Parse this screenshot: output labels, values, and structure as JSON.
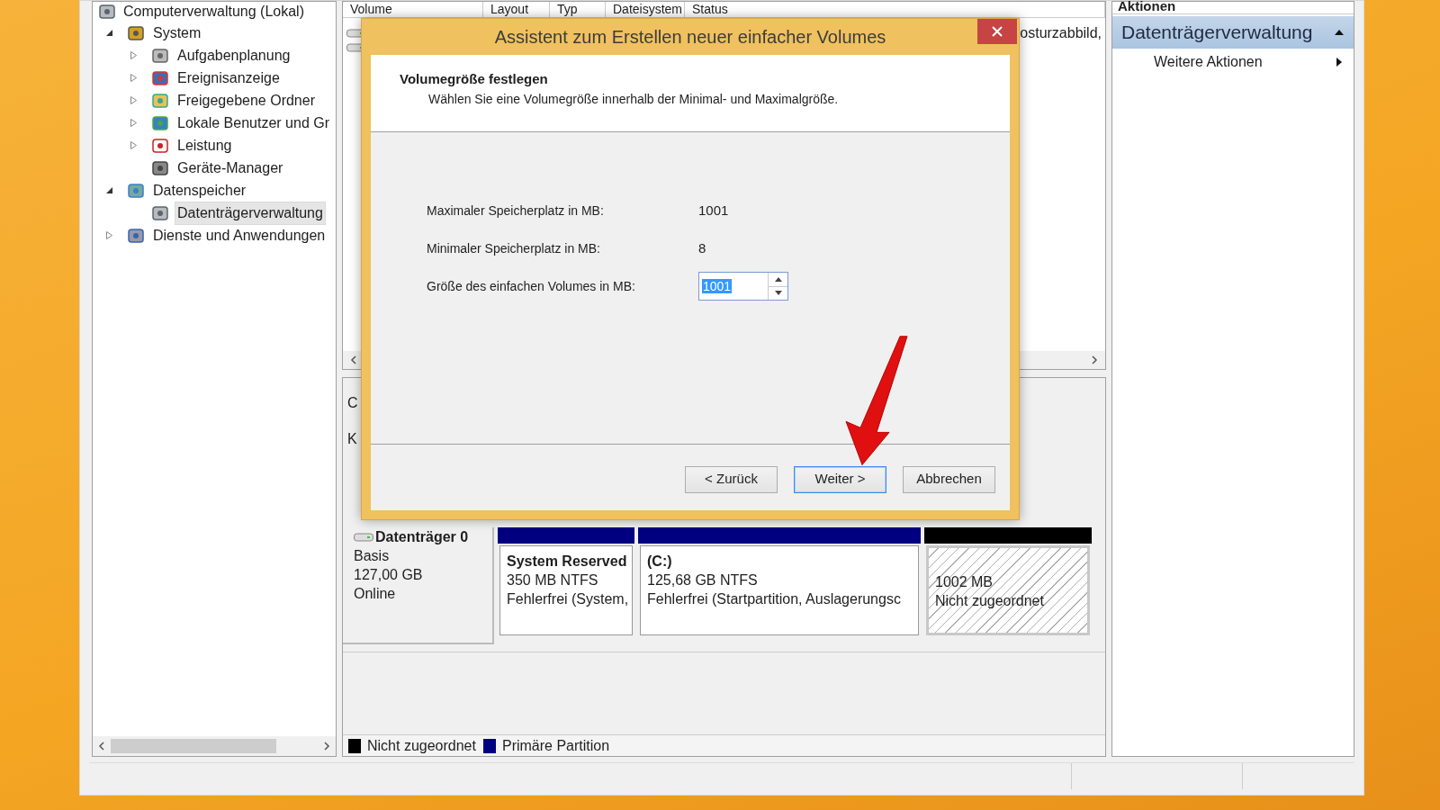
{
  "tree": {
    "root": "Computerverwaltung (Lokal)",
    "items": [
      {
        "label": "System",
        "kind": "node",
        "expanded": true,
        "selected": false,
        "children": [
          {
            "label": "Aufgabenplanung",
            "kind": "node",
            "expanded": false,
            "selected": false
          },
          {
            "label": "Ereignisanzeige",
            "kind": "node",
            "expanded": false,
            "selected": false
          },
          {
            "label": "Freigegebene Ordner",
            "kind": "node",
            "expanded": false,
            "selected": false
          },
          {
            "label": "Lokale Benutzer und Gr",
            "kind": "node",
            "expanded": false,
            "selected": false
          },
          {
            "label": "Leistung",
            "kind": "node",
            "expanded": false,
            "selected": false
          },
          {
            "label": "Geräte-Manager",
            "kind": "leaf",
            "selected": false
          }
        ]
      },
      {
        "label": "Datenspeicher",
        "kind": "node",
        "expanded": true,
        "selected": false,
        "children": [
          {
            "label": "Datenträgerverwaltung",
            "kind": "leaf",
            "selected": true
          }
        ]
      },
      {
        "label": "Dienste und Anwendungen",
        "kind": "node",
        "expanded": false,
        "selected": false
      }
    ]
  },
  "volume_list": {
    "columns": [
      "Volume",
      "Layout",
      "Typ",
      "Dateisystem",
      "Status"
    ],
    "rows": [
      {
        "status_fragment": "osturzabbild,"
      }
    ]
  },
  "lower_pane_fragments": [
    "C",
    "K"
  ],
  "disk": {
    "name": "Datenträger 0",
    "type": "Basis",
    "size": "127,00 GB",
    "status": "Online",
    "partitions": [
      {
        "kind": "primary",
        "name": "System Reserved",
        "size": "350 MB NTFS",
        "status": "Fehlerfrei (System,"
      },
      {
        "kind": "primary",
        "name": "(C:)",
        "size": "125,68 GB NTFS",
        "status": "Fehlerfrei (Startpartition, Auslagerungsc"
      },
      {
        "kind": "unallocated",
        "size": "1002 MB",
        "status": "Nicht zugeordnet"
      }
    ]
  },
  "legend": [
    {
      "label": "Nicht zugeordnet",
      "color": "#000000"
    },
    {
      "label": "Primäre Partition",
      "color": "#000080"
    }
  ],
  "actions": {
    "title": "Aktionen",
    "section": {
      "label": "Datenträgerverwaltung",
      "expanded": true
    },
    "items": [
      {
        "label": "Weitere Aktionen"
      }
    ]
  },
  "dialog": {
    "title": "Assistent zum Erstellen neuer einfacher Volumes",
    "heading": "Volumegröße festlegen",
    "subtitle": "Wählen Sie eine Volumegröße innerhalb der Minimal- und Maximalgröße.",
    "fields": [
      {
        "kind": "text",
        "label": "Maximaler Speicherplatz in MB:",
        "value": "1001"
      },
      {
        "kind": "text",
        "label": "Minimaler Speicherplatz in MB:",
        "value": "8"
      },
      {
        "kind": "spin",
        "label": "Größe des einfachen Volumes in MB:",
        "value": "1001"
      }
    ],
    "buttons": [
      {
        "label": "< Zurück",
        "focused": false
      },
      {
        "label": "Weiter >",
        "focused": true
      },
      {
        "label": "Abbrechen",
        "focused": false
      }
    ]
  }
}
